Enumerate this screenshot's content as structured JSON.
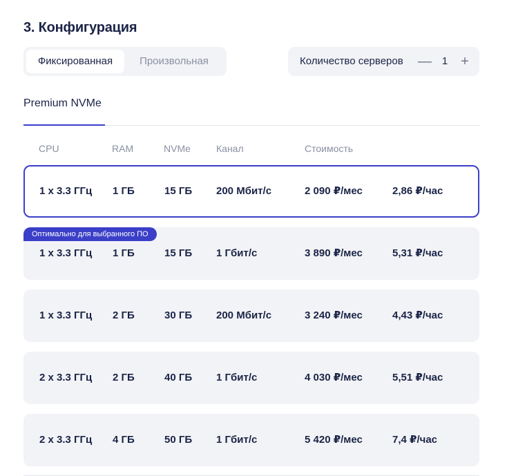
{
  "section_title": "3. Конфигурация",
  "config_mode": {
    "options": [
      "Фиксированная",
      "Произвольная"
    ],
    "selected": "Фиксированная"
  },
  "servers": {
    "label": "Количество серверов",
    "minus": "—",
    "value": "1",
    "plus": "+"
  },
  "tabs": [
    {
      "label": "Premium NVMe",
      "active": true
    }
  ],
  "table": {
    "headers": [
      "CPU",
      "RAM",
      "NVMe",
      "Канал",
      "Стоимость"
    ],
    "badge": "Оптимально для выбранного ПО",
    "rows": [
      {
        "cpu": "1 x 3.3 ГГц",
        "ram": "1 ГБ",
        "nvme": "15 ГБ",
        "channel": "200 Мбит/с",
        "price_month": "2 090 ₽/мес",
        "price_hour": "2,86 ₽/час",
        "selected": true
      },
      {
        "cpu": "1 x 3.3 ГГц",
        "ram": "1 ГБ",
        "nvme": "15 ГБ",
        "channel": "1 Гбит/с",
        "price_month": "3 890 ₽/мес",
        "price_hour": "5,31 ₽/час",
        "badge": true
      },
      {
        "cpu": "1 x 3.3 ГГц",
        "ram": "2 ГБ",
        "nvme": "30 ГБ",
        "channel": "200 Мбит/с",
        "price_month": "3 240 ₽/мес",
        "price_hour": "4,43 ₽/час"
      },
      {
        "cpu": "2 x 3.3 ГГц",
        "ram": "2 ГБ",
        "nvme": "40 ГБ",
        "channel": "1 Гбит/с",
        "price_month": "4 030 ₽/мес",
        "price_hour": "5,51 ₽/час"
      },
      {
        "cpu": "2 x 3.3 ГГц",
        "ram": "4 ГБ",
        "nvme": "50 ГБ",
        "channel": "1 Гбит/с",
        "price_month": "5 420 ₽/мес",
        "price_hour": "7,4 ₽/час"
      }
    ]
  },
  "colors": {
    "accent": "#3b3fc8",
    "row_bg": "#f2f3f6",
    "text": "#1b2447",
    "muted": "#8a90a2"
  }
}
